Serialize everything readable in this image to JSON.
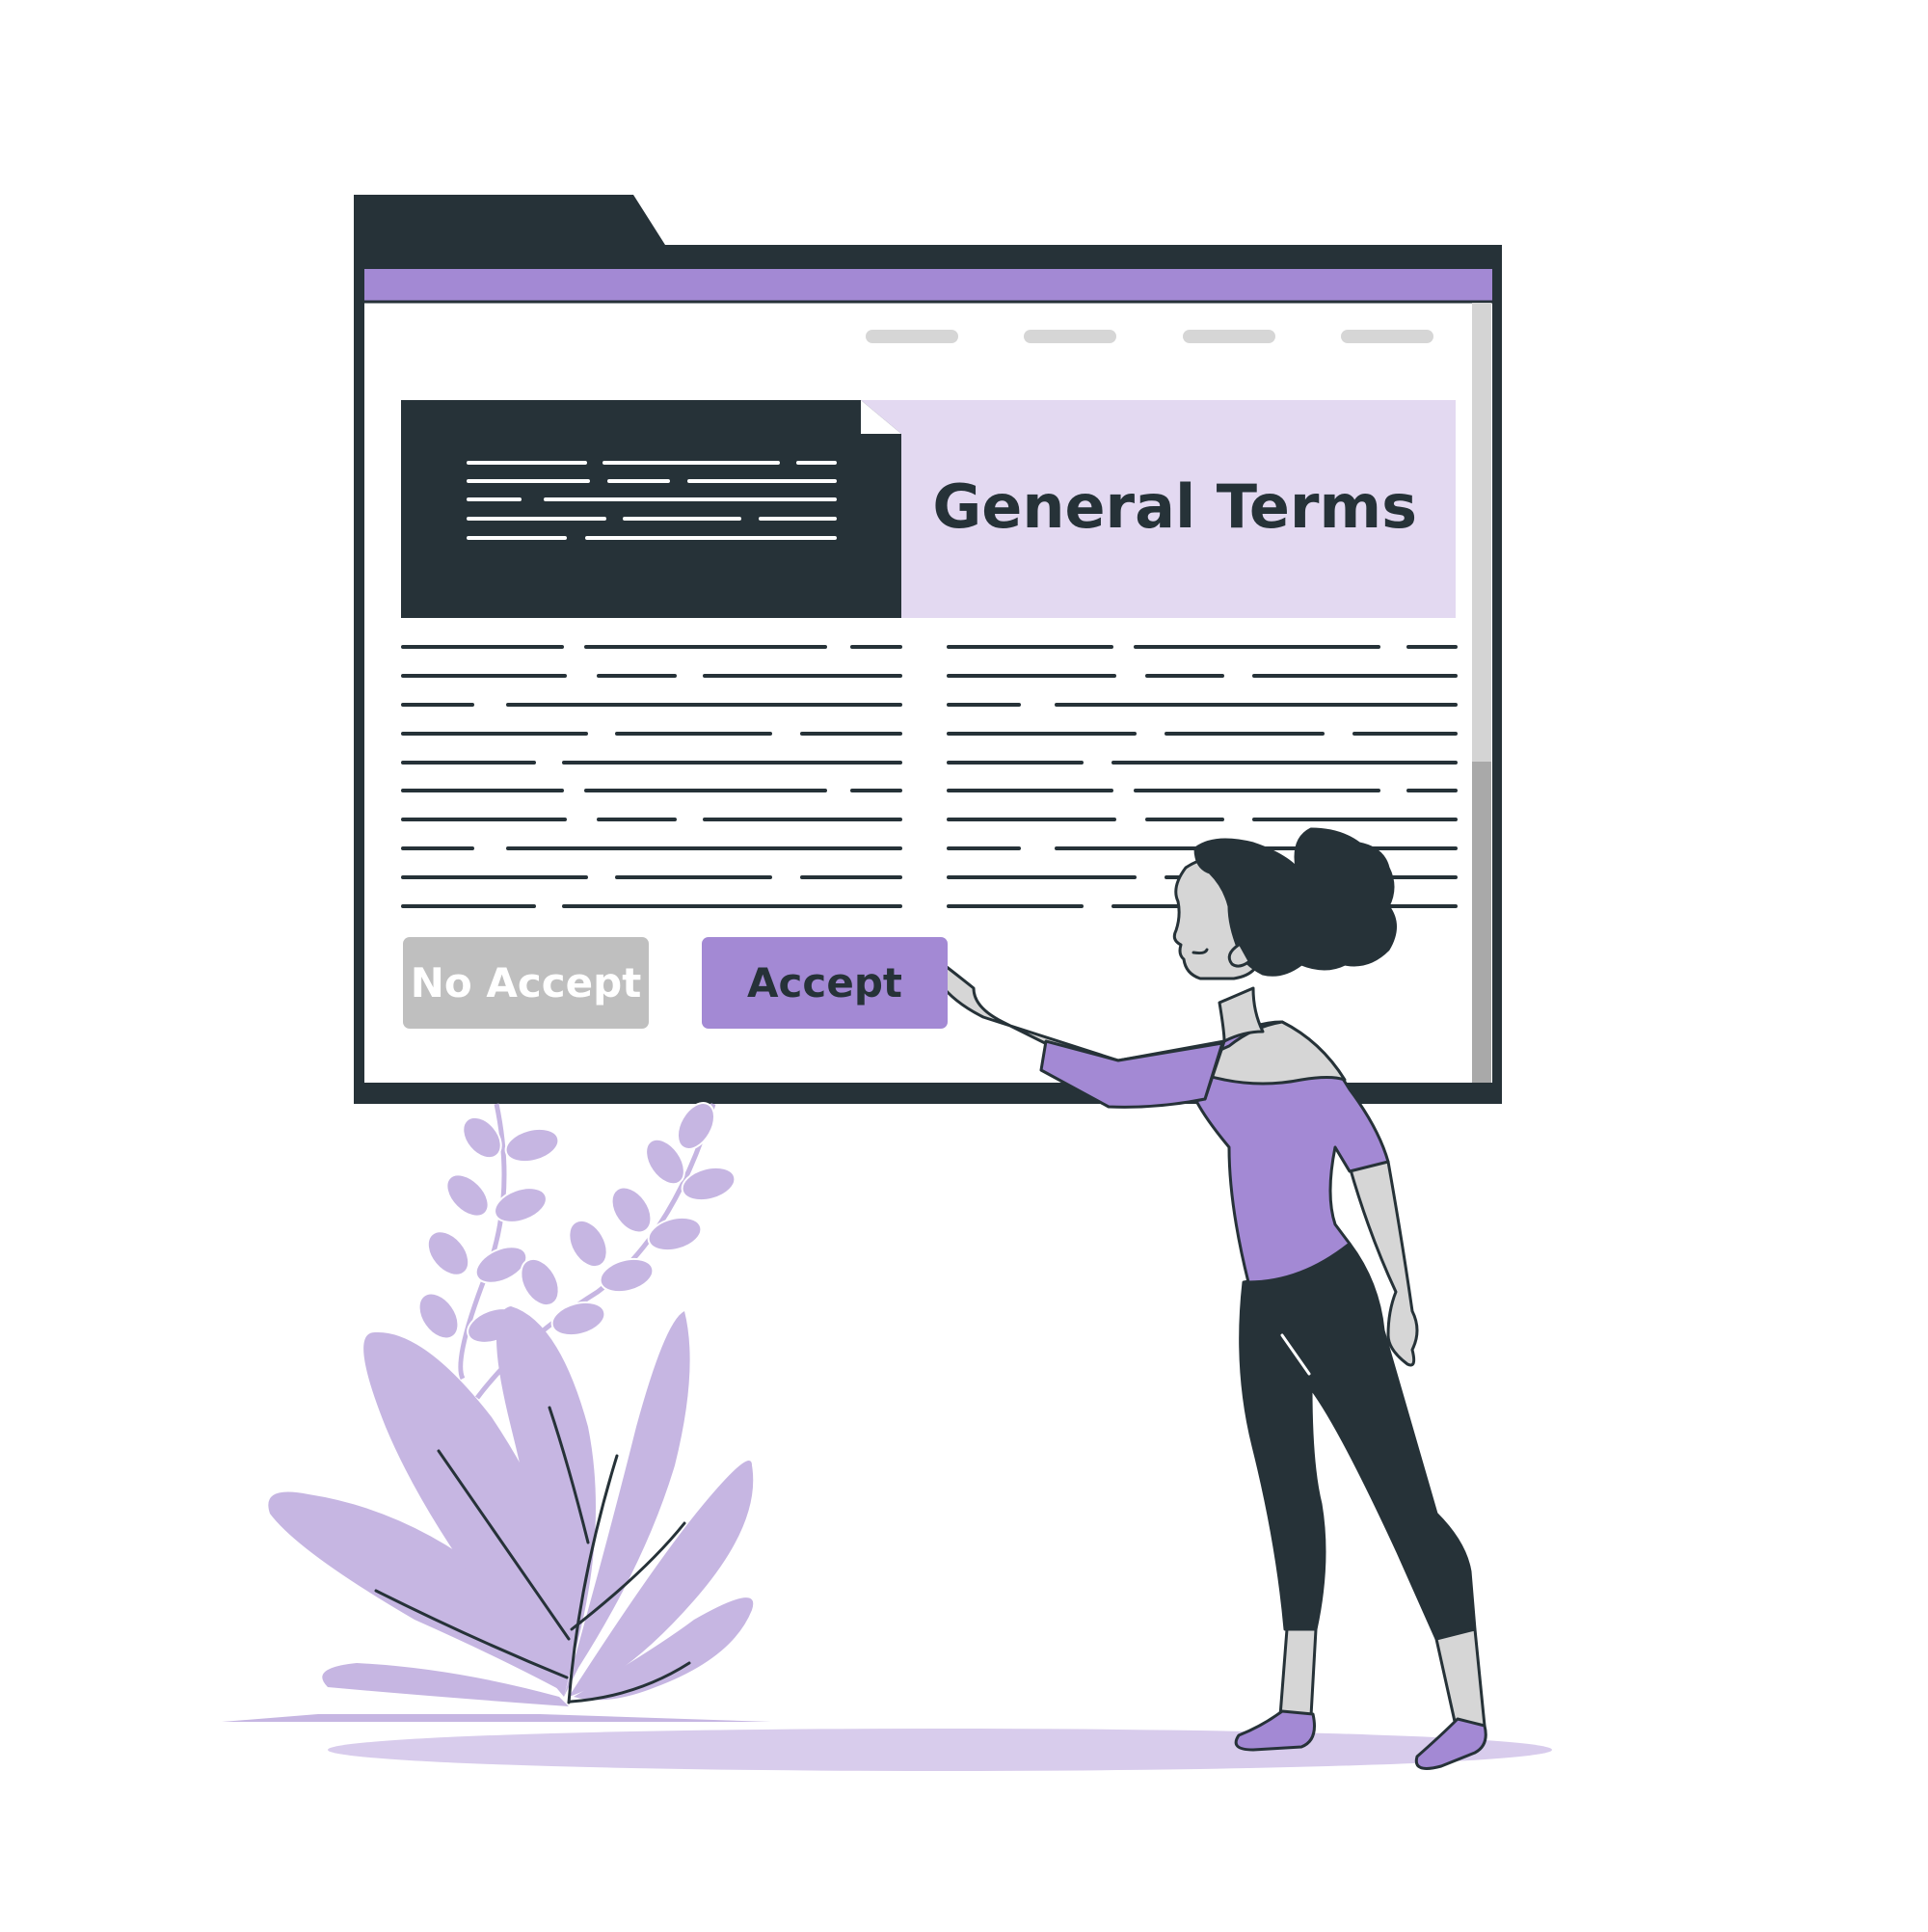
{
  "document": {
    "title": "General Terms"
  },
  "buttons": {
    "decline_label": "No Accept",
    "accept_label": "Accept"
  },
  "colors": {
    "accent": "#a389d4",
    "accent_light": "#e3d9f1",
    "plant": "#c6b6e2",
    "dark": "#263238",
    "gray": "#bfbfbf",
    "nav_pill": "#d6d6d6"
  }
}
